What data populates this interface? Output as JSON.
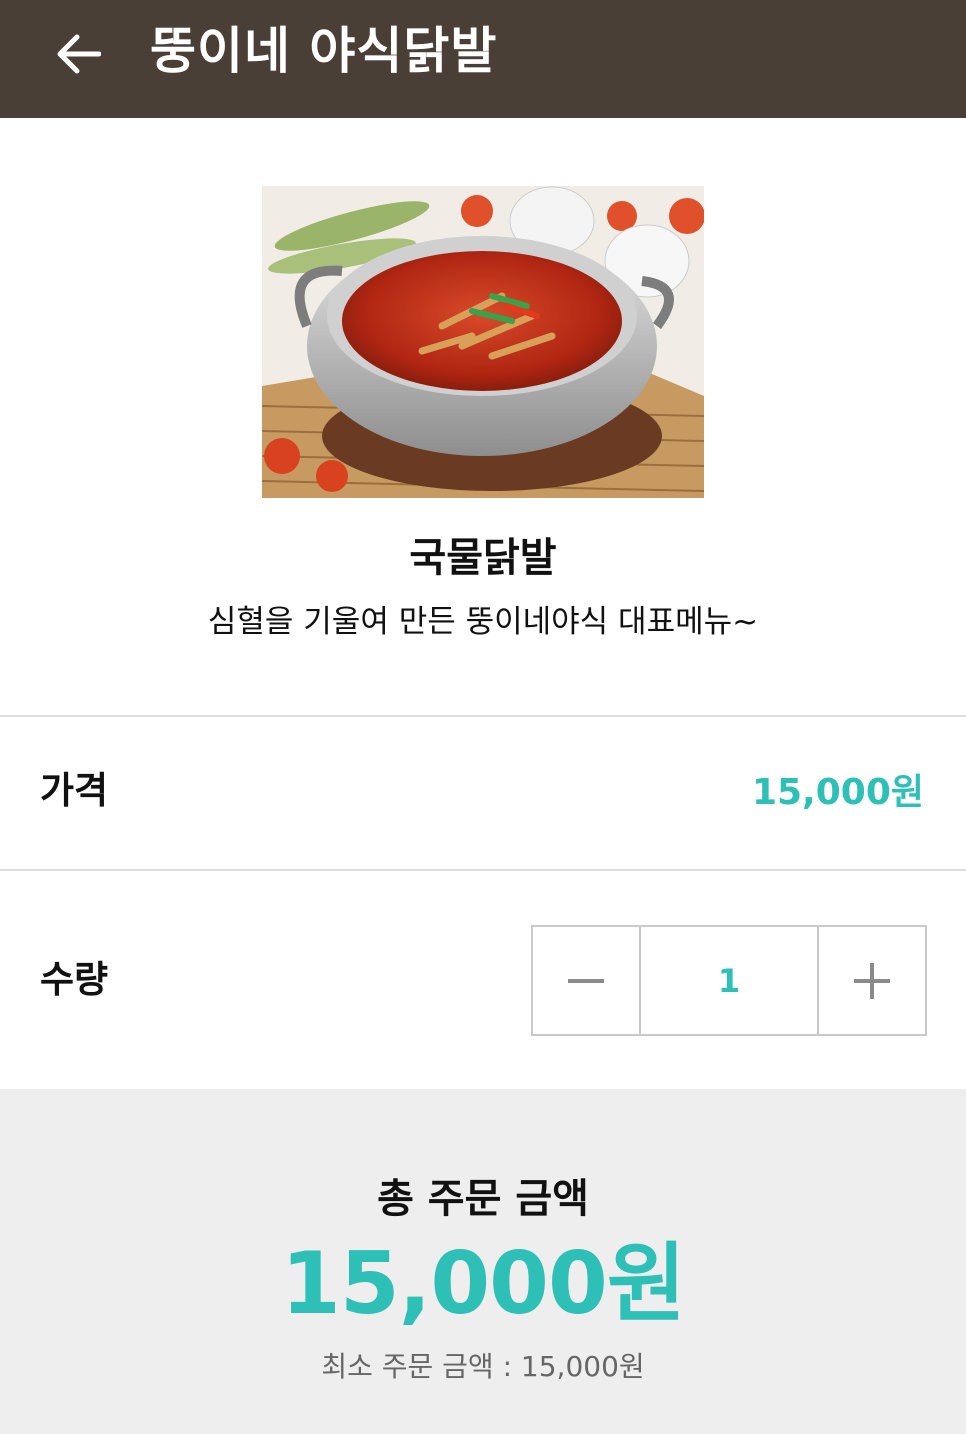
{
  "header": {
    "title": "뚱이네 야식닭발",
    "back_icon": "arrow-left-icon"
  },
  "menu": {
    "name": "국물닭발",
    "description": "심혈을 기울여 만든 뚱이네야식 대표메뉴~"
  },
  "price": {
    "label": "가격",
    "value": "15,000원"
  },
  "quantity": {
    "label": "수량",
    "value": "1",
    "minus_icon": "minus-icon",
    "plus_icon": "plus-icon"
  },
  "summary": {
    "total_label": "총 주문 금액",
    "total_value": "15,000원",
    "min_order": "최소 주문 금액 : 15,000원"
  },
  "colors": {
    "header_bg": "#4a3f37",
    "accent": "#2ebfb6",
    "summary_bg": "#eeeeee"
  }
}
